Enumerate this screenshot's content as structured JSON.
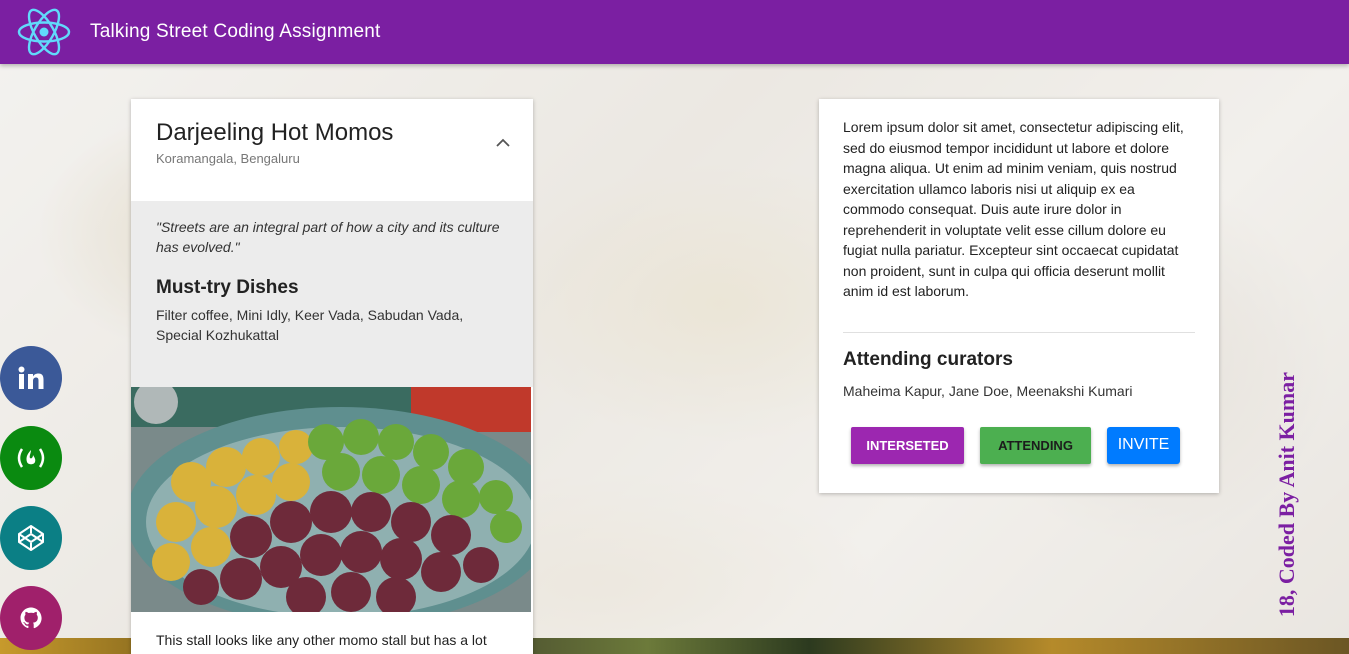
{
  "appbar": {
    "title": "Talking Street Coding Assignment",
    "color": "#7b1fa2",
    "logo_icon": "react-atom-icon"
  },
  "stall": {
    "name": "Darjeeling Hot Momos",
    "location": "Koramangala, Bengaluru",
    "quote": "\"Streets are an integral part of how a city and its culture has evolved.\"",
    "dishes_heading": "Must-try Dishes",
    "dishes": "Filter coffee, Mini Idly, Keer Vada, Sabudan Vada, Special Kozhukattal",
    "description": "This stall looks like any other momo stall but has a lot"
  },
  "details": {
    "lorem": "Lorem ipsum dolor sit amet, consectetur adipiscing elit, sed do eiusmod tempor incididunt ut labore et dolore magna aliqua. Ut enim ad minim veniam, quis nostrud exercitation ullamco laboris nisi ut aliquip ex ea commodo consequat. Duis aute irure dolor in reprehenderit in voluptate velit esse cillum dolore eu fugiat nulla pariatur. Excepteur sint occaecat cupidatat non proident, sunt in culpa qui officia deserunt mollit anim id est laborum.",
    "curators_heading": "Attending curators",
    "curators": "Maheima Kapur, Jane Doe, Meenakshi Kumari",
    "buttons": {
      "interested": "INTERSETED",
      "attending": "ATTENDING",
      "invite": "INVITE"
    },
    "button_colors": {
      "interested": "#9c27b0",
      "attending": "#4caf50",
      "invite": "#007bff"
    }
  },
  "social": [
    {
      "icon": "linkedin-icon",
      "color": "#3b5998"
    },
    {
      "icon": "freecodecamp-icon",
      "color": "#0a8a10"
    },
    {
      "icon": "codepen-icon",
      "color": "#0b7f85"
    },
    {
      "icon": "github-icon",
      "color": "#a0206b"
    }
  ],
  "credit": "18, Coded By Anit Kumar"
}
